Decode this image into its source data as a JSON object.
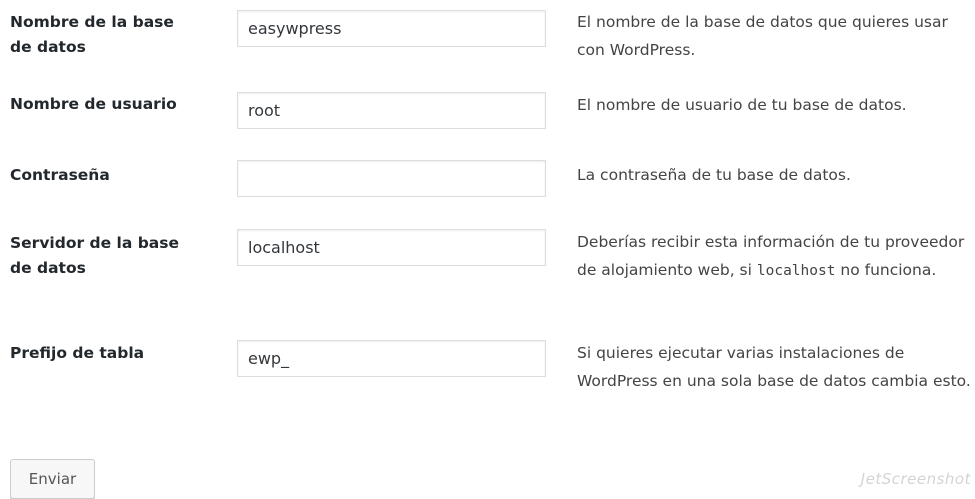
{
  "form": {
    "rows": [
      {
        "label": "Nombre de la base de datos",
        "value": "easywpress",
        "description": "El nombre de la base de datos que quieres usar con WordPress."
      },
      {
        "label": "Nombre de usuario",
        "value": "root",
        "description": "El nombre de usuario de tu base de datos."
      },
      {
        "label": "Contraseña",
        "value": "",
        "description": "La contraseña de tu base de datos."
      },
      {
        "label": "Servidor de la base de datos",
        "value": "localhost",
        "description_before": "Deberías recibir esta información de tu proveedor de alojamiento web, si ",
        "description_code": "localhost",
        "description_after": " no funciona."
      },
      {
        "label": "Prefijo de tabla",
        "value": "ewp_",
        "description": "Si quieres ejecutar varias instalaciones de WordPress en una sola base de datos cambia esto."
      }
    ],
    "submit_label": "Enviar"
  },
  "watermark": "JetScreenshot"
}
